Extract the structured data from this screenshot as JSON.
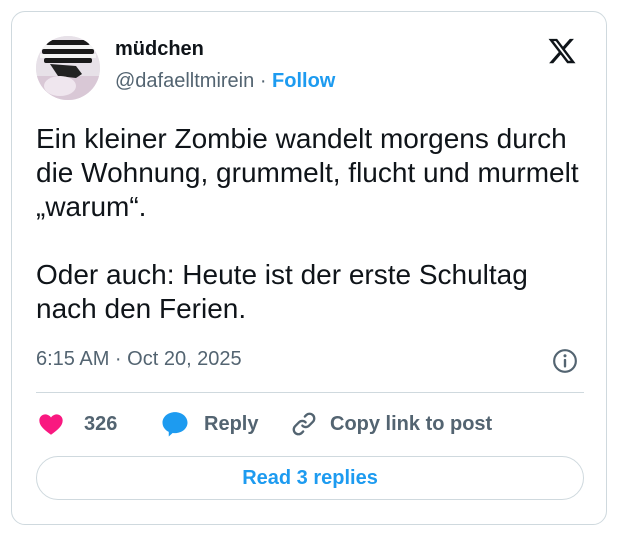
{
  "tweet": {
    "author": {
      "display_name": "müdchen",
      "handle": "@dafaelltmirein",
      "separator": "·",
      "follow_label": "Follow"
    },
    "logo_icon": "x-logo-icon",
    "text": [
      "Ein kleiner Zombie wandelt morgens durch die Wohnung, grummelt, flucht und murmelt „warum“.",
      "Oder auch: Heute ist der erste Schultag nach den Ferien."
    ],
    "timestamp": "6:15 AM · Oct 20, 2025",
    "info_icon": "info-icon",
    "actions": {
      "like_count": "326",
      "reply_label": "Reply",
      "copy_label": "Copy link to post"
    },
    "read_replies_label": "Read 3 replies"
  },
  "colors": {
    "accent": "#1d9bf0",
    "like": "#f91880",
    "text": "#0f1419",
    "muted": "#536471",
    "border": "#cfd9de"
  }
}
